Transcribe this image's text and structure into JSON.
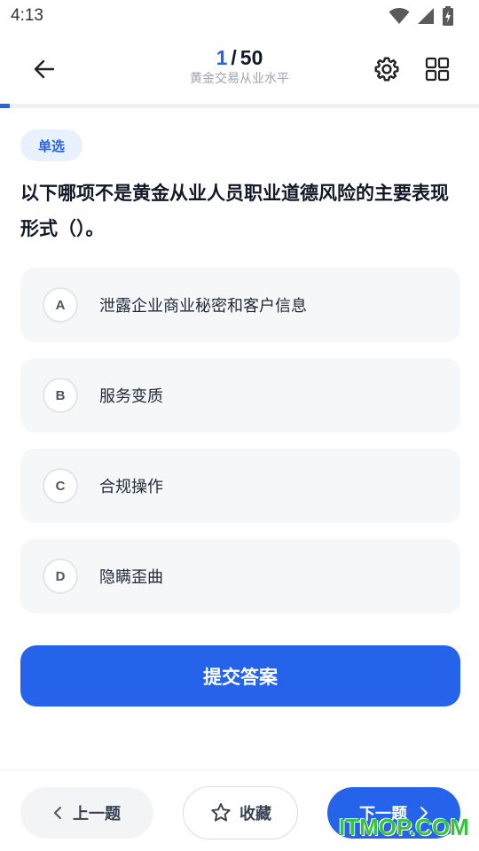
{
  "status_bar": {
    "time": "4:13"
  },
  "header": {
    "progress_current": "1",
    "progress_separator": "/",
    "progress_total": "50",
    "subtitle": "黄金交易从业水平",
    "progress_fraction": 0.02
  },
  "question": {
    "type_label": "单选",
    "text": "以下哪项不是黄金从业人员职业道德风险的主要表现形式（）。",
    "options": [
      {
        "letter": "A",
        "text": "泄露企业商业秘密和客户信息"
      },
      {
        "letter": "B",
        "text": "服务变质"
      },
      {
        "letter": "C",
        "text": "合规操作"
      },
      {
        "letter": "D",
        "text": "隐瞒歪曲"
      }
    ]
  },
  "actions": {
    "submit_label": "提交答案"
  },
  "bottom_bar": {
    "prev_label": "上一题",
    "favorite_label": "收藏",
    "next_label": "下一题"
  },
  "watermark": "ITMOP.COM",
  "colors": {
    "accent": "#2563eb",
    "badge_bg": "#eaf1fe",
    "option_bg": "#f6f7f9",
    "watermark": "#35c43c"
  },
  "icons": [
    "wifi-icon",
    "signal-icon",
    "battery-icon",
    "back-arrow-icon",
    "settings-gear-icon",
    "grid-icon",
    "chevron-left-icon",
    "star-icon",
    "chevron-right-icon"
  ]
}
